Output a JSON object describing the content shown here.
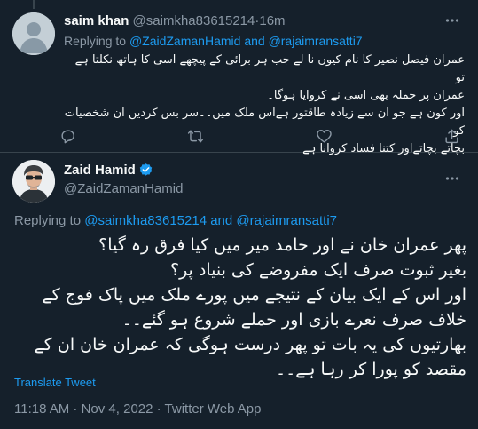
{
  "reply_tweet": {
    "author_name": "saim khan",
    "handle": "@saimkha83615214",
    "separator": "·",
    "time": "16m",
    "replying_prefix": "Replying to",
    "replying_user1": "@ZaidZamanHamid",
    "replying_and": "and",
    "replying_user2": "@rajaimransatti7",
    "text_lines": [
      "عمران فیصل نصیر کا نام کیوں نا لے جب ہر برائی کے پیچھے اسی کا ہاتھ نکلتا ہے تو",
      "عمران پر حملہ بھی اسی نے کروایا ہوگا۔",
      "اور کون ہے جو ان سے زیادہ طاقتور ہےاس ملک میں۔۔سر بس کردیں ان شخصیات کو",
      "بچاتے بچاتےاور کتنا فساد کروانا ہے"
    ],
    "actions": [
      "reply-icon",
      "retweet-icon",
      "like-icon",
      "share-icon"
    ]
  },
  "main_tweet": {
    "author_name": "Zaid Hamid",
    "handle": "@ZaidZamanHamid",
    "verified": true,
    "replying_prefix": "Replying to",
    "replying_user1": "@saimkha83615214",
    "replying_and": "and",
    "replying_user2": "@rajaimransatti7",
    "text_lines": [
      "پھر عمران خان نے اور حامد میر میں کیا فرق رہ گیا؟",
      "بغیر ثبوت صرف ایک مفروضے کی بنیاد پر؟",
      "اور اس کے ایک بیان کے نتیجے میں پورے ملک میں پاک فوج کے",
      "خلاف صرف نعرے بازی اور حملے شروع ہو گئے۔۔",
      "بھارتیوں کی یہ بات تو پھر درست ہوگی کہ عمران خان ان کے",
      "مقصد کو پورا کر رہا ہے۔۔"
    ],
    "translate_label": "Translate Tweet",
    "timestamp": "11:18 AM · Nov 4, 2022 · Twitter Web App"
  },
  "colors": {
    "background": "#15202b",
    "accent": "#1d9bf0",
    "muted_text": "#8b98a5",
    "divider": "#38444d"
  }
}
